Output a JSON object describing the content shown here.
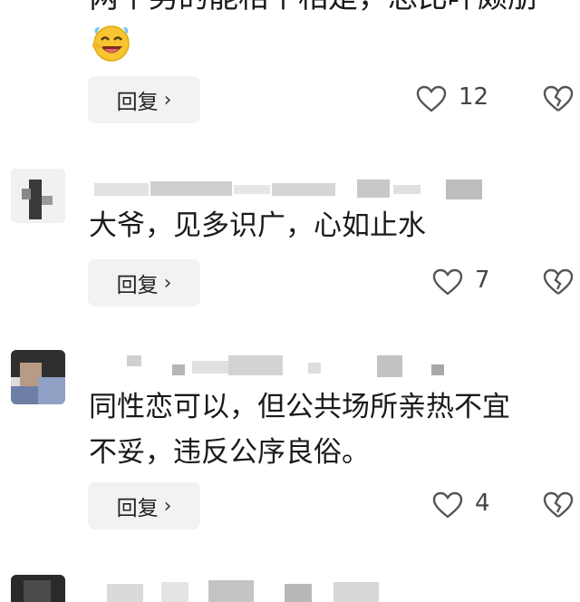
{
  "top_comment": {
    "text_partial": "两个男的能相个相是，总比吓颇朋",
    "emoji": "laughing-face-emoji",
    "reply_label": "回复",
    "like_count": "12"
  },
  "comments": [
    {
      "text_lines": [
        "大爷，见多识广，心如止水"
      ],
      "reply_label": "回复",
      "like_count": "7"
    },
    {
      "text_lines": [
        "同性恋可以，但公共场所亲热不宜",
        "不妥，违反公序良俗。"
      ],
      "reply_label": "回复",
      "like_count": "4"
    }
  ],
  "colors": {
    "text": "#1a1a1a",
    "reply_bg": "#f2f2f2",
    "icon": "#555555"
  }
}
